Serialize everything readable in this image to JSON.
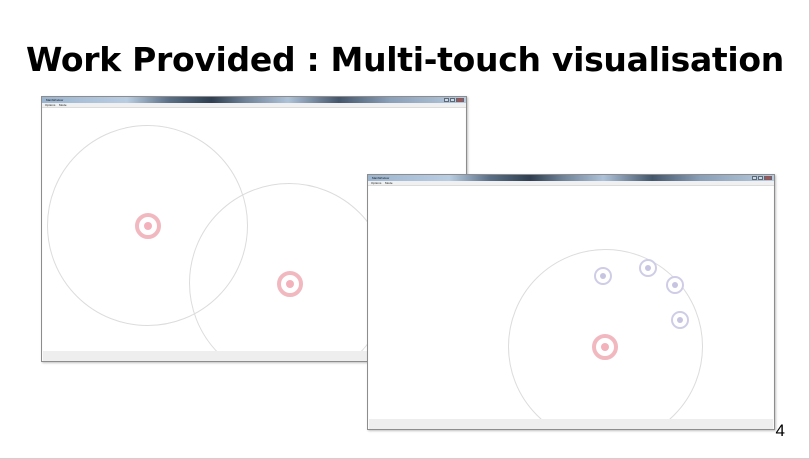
{
  "slide": {
    "title": "Work Provided : Multi-touch visualisation",
    "page_number": "4"
  },
  "windows": [
    {
      "title": "MainWindow",
      "menu": [
        "Options",
        "Mode"
      ]
    },
    {
      "title": "MainWindow",
      "menu": [
        "Options",
        "Mode"
      ]
    }
  ],
  "colors": {
    "primary_touch": "#f2b8c0",
    "secondary_touch": "#cfcde6",
    "touch_radius_ring": "#dcdcdc"
  }
}
